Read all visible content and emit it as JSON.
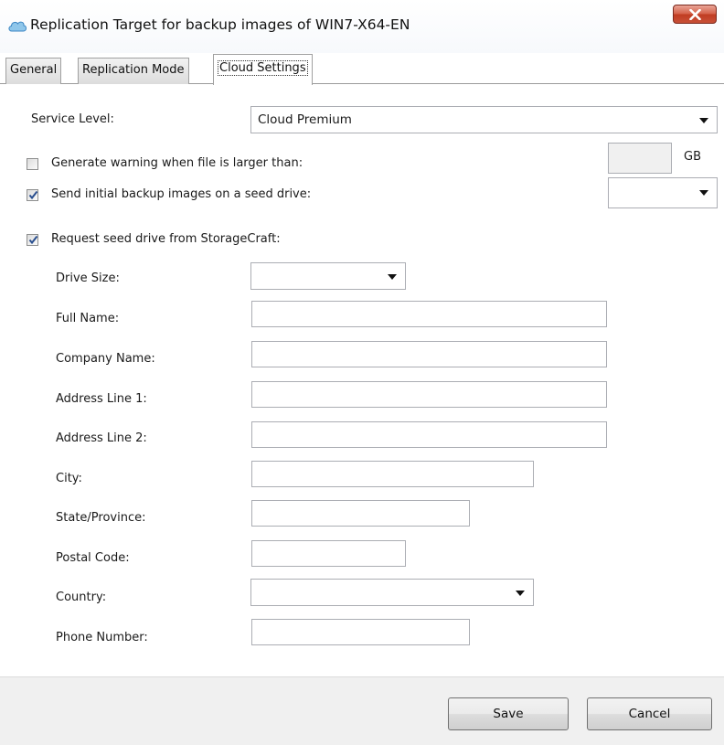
{
  "window": {
    "title": "Replication Target for backup images of WIN7-X64-EN",
    "icon": "cloud-icon",
    "close_icon": "close-icon"
  },
  "tabs": [
    {
      "label": "General"
    },
    {
      "label": "Replication Mode"
    },
    {
      "label": "Cloud Settings",
      "active": true
    }
  ],
  "cloud_settings": {
    "service_level": {
      "label": "Service Level:",
      "value": "Cloud Premium"
    },
    "warn_large_file": {
      "label": "Generate warning when file is larger than:",
      "checked": false,
      "value": "",
      "unit": "GB"
    },
    "seed_drive": {
      "label": "Send initial backup images on a seed drive:",
      "checked": true,
      "value": ""
    },
    "request_seed": {
      "label": "Request seed drive from StorageCraft:",
      "checked": true
    }
  },
  "seed_request": {
    "drive_size": {
      "label": "Drive Size:",
      "value": ""
    },
    "full_name": {
      "label": "Full Name:",
      "value": ""
    },
    "company_name": {
      "label": "Company Name:",
      "value": ""
    },
    "address_line_1": {
      "label": "Address Line 1:",
      "value": ""
    },
    "address_line_2": {
      "label": "Address Line 2:",
      "value": ""
    },
    "city": {
      "label": "City:",
      "value": ""
    },
    "state_province": {
      "label": "State/Province:",
      "value": ""
    },
    "postal_code": {
      "label": "Postal Code:",
      "value": ""
    },
    "country": {
      "label": "Country:",
      "value": ""
    },
    "phone_number": {
      "label": "Phone Number:",
      "value": ""
    }
  },
  "buttons": {
    "save": "Save",
    "cancel": "Cancel"
  },
  "colors": {
    "close_button": "#c8452c",
    "checkmark": "#2a4f8f",
    "footer": "#f0f0f0"
  }
}
